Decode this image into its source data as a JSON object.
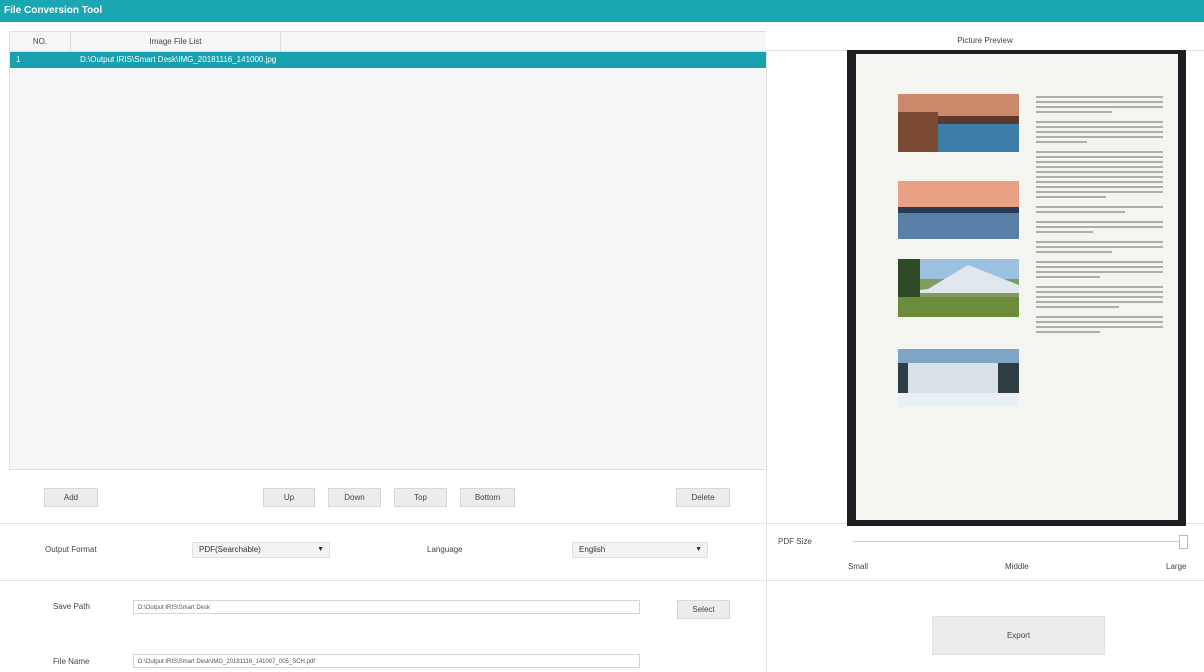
{
  "app": {
    "title": "File Conversion Tool"
  },
  "file_list": {
    "headers": {
      "no": "NO.",
      "file": "Image File List"
    },
    "rows": [
      {
        "no": "1",
        "path": "D:\\Output IRIS\\Smart Desk\\IMG_20181116_141000.jpg",
        "selected": true
      }
    ]
  },
  "buttons": {
    "add": "Add",
    "up": "Up",
    "down": "Down",
    "top": "Top",
    "bottom": "Bottom",
    "delete": "Delete",
    "select": "Select",
    "export": "Export"
  },
  "options": {
    "output_format_label": "Output Format",
    "output_format_value": "PDF(Searchable)",
    "language_label": "Language",
    "language_value": "English"
  },
  "paths": {
    "save_path_label": "Save Path",
    "save_path_value": "D:\\Output IRIS\\Smart Desk",
    "file_name_label": "File Name",
    "file_name_value": "D:\\Output IRIS\\Smart Desk\\IMG_20181116_141007_005_SCH.pdf"
  },
  "preview": {
    "title": "Picture Preview"
  },
  "pdf_size": {
    "label": "PDF Size",
    "small": "Small",
    "middle": "Middle",
    "large": "Large",
    "level": 1.0
  },
  "colors": {
    "accent": "#1aa6b2",
    "selected_row": "#17a0ad"
  }
}
